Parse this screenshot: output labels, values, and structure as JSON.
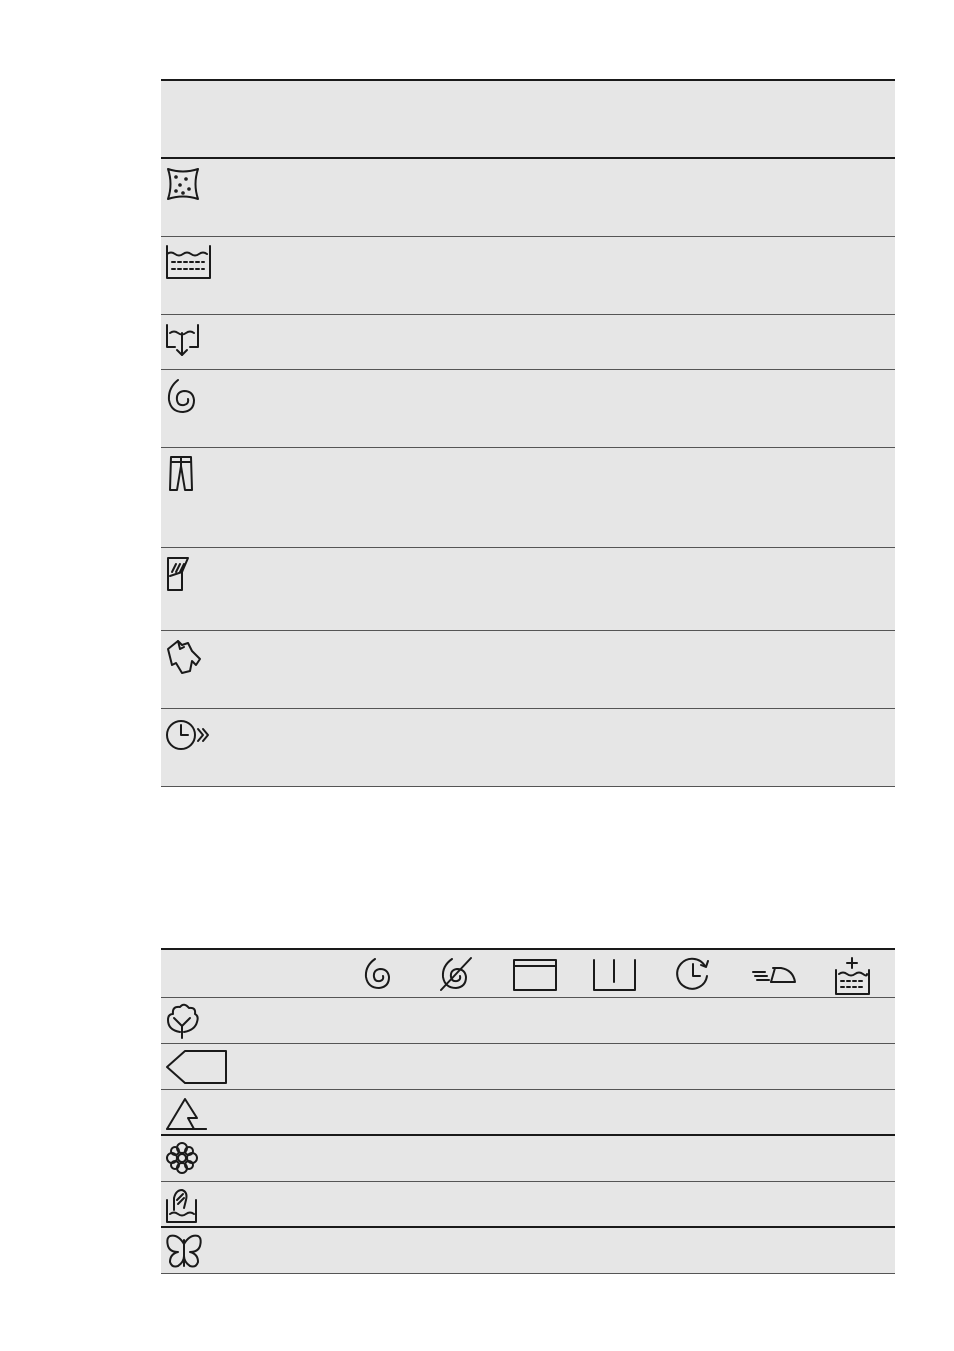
{
  "options_table": {
    "header": "",
    "rows": [
      {
        "icon": "stain-icon",
        "height": 78
      },
      {
        "icon": "prewash-icon",
        "height": 78
      },
      {
        "icon": "no-spin-drain-icon",
        "height": 55
      },
      {
        "icon": "spin-icon",
        "height": 78
      },
      {
        "icon": "jeans-icon",
        "height": 100
      },
      {
        "icon": "delicate-rinse-icon",
        "height": 83
      },
      {
        "icon": "shirt-icon",
        "height": 78
      },
      {
        "icon": "time-save-icon",
        "height": 78
      }
    ]
  },
  "compatibility_table": {
    "columns": [
      {
        "icon": "spin-icon"
      },
      {
        "icon": "no-spin-icon"
      },
      {
        "icon": "rinse-hold-icon"
      },
      {
        "icon": "night-cycle-icon"
      },
      {
        "icon": "delay-start-icon"
      },
      {
        "icon": "easy-iron-icon"
      },
      {
        "icon": "extra-rinse-icon"
      }
    ],
    "rows": [
      {
        "icon": "cotton-icon"
      },
      {
        "icon": "synthetics-icon"
      },
      {
        "icon": "easy-iron-triangle-icon"
      },
      {
        "icon": "delicates-icon"
      },
      {
        "icon": "wool-hand-wash-icon"
      },
      {
        "icon": "silk-icon"
      }
    ]
  },
  "colors": {
    "grid_bg": "#e6e6e6",
    "line": "#1a1a1a"
  }
}
